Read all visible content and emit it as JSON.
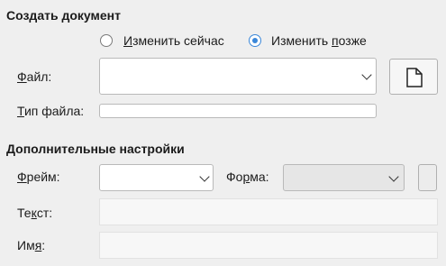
{
  "create_section": {
    "title": "Создать документ",
    "radio_now": {
      "prefix": "И",
      "rest": "зменить сейчас",
      "checked": false
    },
    "radio_later": {
      "prefix": "Изменить ",
      "underlined": "п",
      "rest": "озже",
      "checked": true
    },
    "file_label_u": "Ф",
    "file_label_rest": "айл:",
    "file_value": "",
    "new_doc_icon": "new-document-icon",
    "filetype_label_u": "Т",
    "filetype_label_rest": "ип файла:",
    "filetype_value": ""
  },
  "extra_section": {
    "title": "Дополнительные настройки",
    "frame_label_u": "Ф",
    "frame_label_rest": "рейм:",
    "frame_value": "",
    "form_label_pre": "Фо",
    "form_label_u": "р",
    "form_label_rest": "ма:",
    "form_value": "",
    "text_label_pre": "Те",
    "text_label_u": "к",
    "text_label_rest": "ст:",
    "text_value": "",
    "name_label_pre": "Им",
    "name_label_u": "я",
    "name_label_rest": ":",
    "name_value": ""
  },
  "colors": {
    "accent": "#3a87d9",
    "background": "#efefef"
  }
}
